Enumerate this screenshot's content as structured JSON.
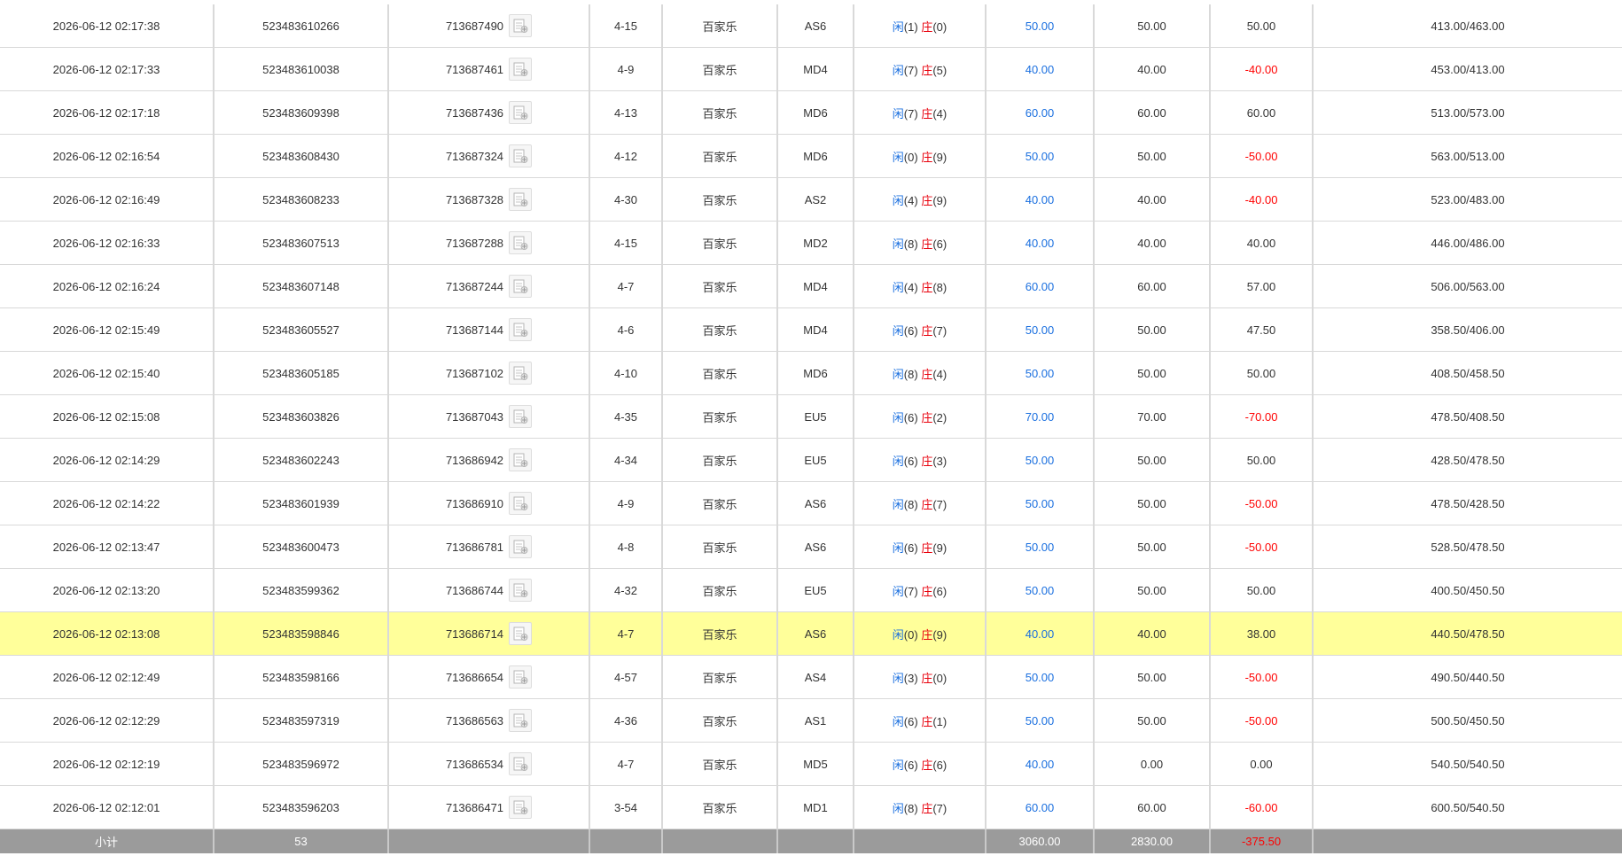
{
  "table": {
    "rows": [
      {
        "time": "2026-06-12 02:17:38",
        "order_no": "523483610266",
        "round_no": "713687490",
        "shoe": "4-15",
        "game": "百家乐",
        "table": "AS6",
        "player_label": "闲",
        "player_pts": "(1)",
        "banker_label": "庄",
        "banker_pts": "(0)",
        "bet": "50.00",
        "valid_bet": "50.00",
        "win_loss": "50.00",
        "win_loss_neg": false,
        "balance": "413.00/463.00",
        "highlight": false
      },
      {
        "time": "2026-06-12 02:17:33",
        "order_no": "523483610038",
        "round_no": "713687461",
        "shoe": "4-9",
        "game": "百家乐",
        "table": "MD4",
        "player_label": "闲",
        "player_pts": "(7)",
        "banker_label": "庄",
        "banker_pts": "(5)",
        "bet": "40.00",
        "valid_bet": "40.00",
        "win_loss": "-40.00",
        "win_loss_neg": true,
        "balance": "453.00/413.00",
        "highlight": false
      },
      {
        "time": "2026-06-12 02:17:18",
        "order_no": "523483609398",
        "round_no": "713687436",
        "shoe": "4-13",
        "game": "百家乐",
        "table": "MD6",
        "player_label": "闲",
        "player_pts": "(7)",
        "banker_label": "庄",
        "banker_pts": "(4)",
        "bet": "60.00",
        "valid_bet": "60.00",
        "win_loss": "60.00",
        "win_loss_neg": false,
        "balance": "513.00/573.00",
        "highlight": false
      },
      {
        "time": "2026-06-12 02:16:54",
        "order_no": "523483608430",
        "round_no": "713687324",
        "shoe": "4-12",
        "game": "百家乐",
        "table": "MD6",
        "player_label": "闲",
        "player_pts": "(0)",
        "banker_label": "庄",
        "banker_pts": "(9)",
        "bet": "50.00",
        "valid_bet": "50.00",
        "win_loss": "-50.00",
        "win_loss_neg": true,
        "balance": "563.00/513.00",
        "highlight": false
      },
      {
        "time": "2026-06-12 02:16:49",
        "order_no": "523483608233",
        "round_no": "713687328",
        "shoe": "4-30",
        "game": "百家乐",
        "table": "AS2",
        "player_label": "闲",
        "player_pts": "(4)",
        "banker_label": "庄",
        "banker_pts": "(9)",
        "bet": "40.00",
        "valid_bet": "40.00",
        "win_loss": "-40.00",
        "win_loss_neg": true,
        "balance": "523.00/483.00",
        "highlight": false
      },
      {
        "time": "2026-06-12 02:16:33",
        "order_no": "523483607513",
        "round_no": "713687288",
        "shoe": "4-15",
        "game": "百家乐",
        "table": "MD2",
        "player_label": "闲",
        "player_pts": "(8)",
        "banker_label": "庄",
        "banker_pts": "(6)",
        "bet": "40.00",
        "valid_bet": "40.00",
        "win_loss": "40.00",
        "win_loss_neg": false,
        "balance": "446.00/486.00",
        "highlight": false
      },
      {
        "time": "2026-06-12 02:16:24",
        "order_no": "523483607148",
        "round_no": "713687244",
        "shoe": "4-7",
        "game": "百家乐",
        "table": "MD4",
        "player_label": "闲",
        "player_pts": "(4)",
        "banker_label": "庄",
        "banker_pts": "(8)",
        "bet": "60.00",
        "valid_bet": "60.00",
        "win_loss": "57.00",
        "win_loss_neg": false,
        "balance": "506.00/563.00",
        "highlight": false
      },
      {
        "time": "2026-06-12 02:15:49",
        "order_no": "523483605527",
        "round_no": "713687144",
        "shoe": "4-6",
        "game": "百家乐",
        "table": "MD4",
        "player_label": "闲",
        "player_pts": "(6)",
        "banker_label": "庄",
        "banker_pts": "(7)",
        "bet": "50.00",
        "valid_bet": "50.00",
        "win_loss": "47.50",
        "win_loss_neg": false,
        "balance": "358.50/406.00",
        "highlight": false
      },
      {
        "time": "2026-06-12 02:15:40",
        "order_no": "523483605185",
        "round_no": "713687102",
        "shoe": "4-10",
        "game": "百家乐",
        "table": "MD6",
        "player_label": "闲",
        "player_pts": "(8)",
        "banker_label": "庄",
        "banker_pts": "(4)",
        "bet": "50.00",
        "valid_bet": "50.00",
        "win_loss": "50.00",
        "win_loss_neg": false,
        "balance": "408.50/458.50",
        "highlight": false
      },
      {
        "time": "2026-06-12 02:15:08",
        "order_no": "523483603826",
        "round_no": "713687043",
        "shoe": "4-35",
        "game": "百家乐",
        "table": "EU5",
        "player_label": "闲",
        "player_pts": "(6)",
        "banker_label": "庄",
        "banker_pts": "(2)",
        "bet": "70.00",
        "valid_bet": "70.00",
        "win_loss": "-70.00",
        "win_loss_neg": true,
        "balance": "478.50/408.50",
        "highlight": false
      },
      {
        "time": "2026-06-12 02:14:29",
        "order_no": "523483602243",
        "round_no": "713686942",
        "shoe": "4-34",
        "game": "百家乐",
        "table": "EU5",
        "player_label": "闲",
        "player_pts": "(6)",
        "banker_label": "庄",
        "banker_pts": "(3)",
        "bet": "50.00",
        "valid_bet": "50.00",
        "win_loss": "50.00",
        "win_loss_neg": false,
        "balance": "428.50/478.50",
        "highlight": false
      },
      {
        "time": "2026-06-12 02:14:22",
        "order_no": "523483601939",
        "round_no": "713686910",
        "shoe": "4-9",
        "game": "百家乐",
        "table": "AS6",
        "player_label": "闲",
        "player_pts": "(8)",
        "banker_label": "庄",
        "banker_pts": "(7)",
        "bet": "50.00",
        "valid_bet": "50.00",
        "win_loss": "-50.00",
        "win_loss_neg": true,
        "balance": "478.50/428.50",
        "highlight": false
      },
      {
        "time": "2026-06-12 02:13:47",
        "order_no": "523483600473",
        "round_no": "713686781",
        "shoe": "4-8",
        "game": "百家乐",
        "table": "AS6",
        "player_label": "闲",
        "player_pts": "(6)",
        "banker_label": "庄",
        "banker_pts": "(9)",
        "bet": "50.00",
        "valid_bet": "50.00",
        "win_loss": "-50.00",
        "win_loss_neg": true,
        "balance": "528.50/478.50",
        "highlight": false
      },
      {
        "time": "2026-06-12 02:13:20",
        "order_no": "523483599362",
        "round_no": "713686744",
        "shoe": "4-32",
        "game": "百家乐",
        "table": "EU5",
        "player_label": "闲",
        "player_pts": "(7)",
        "banker_label": "庄",
        "banker_pts": "(6)",
        "bet": "50.00",
        "valid_bet": "50.00",
        "win_loss": "50.00",
        "win_loss_neg": false,
        "balance": "400.50/450.50",
        "highlight": false
      },
      {
        "time": "2026-06-12 02:13:08",
        "order_no": "523483598846",
        "round_no": "713686714",
        "shoe": "4-7",
        "game": "百家乐",
        "table": "AS6",
        "player_label": "闲",
        "player_pts": "(0)",
        "banker_label": "庄",
        "banker_pts": "(9)",
        "bet": "40.00",
        "valid_bet": "40.00",
        "win_loss": "38.00",
        "win_loss_neg": false,
        "balance": "440.50/478.50",
        "highlight": true
      },
      {
        "time": "2026-06-12 02:12:49",
        "order_no": "523483598166",
        "round_no": "713686654",
        "shoe": "4-57",
        "game": "百家乐",
        "table": "AS4",
        "player_label": "闲",
        "player_pts": "(3)",
        "banker_label": "庄",
        "banker_pts": "(0)",
        "bet": "50.00",
        "valid_bet": "50.00",
        "win_loss": "-50.00",
        "win_loss_neg": true,
        "balance": "490.50/440.50",
        "highlight": false
      },
      {
        "time": "2026-06-12 02:12:29",
        "order_no": "523483597319",
        "round_no": "713686563",
        "shoe": "4-36",
        "game": "百家乐",
        "table": "AS1",
        "player_label": "闲",
        "player_pts": "(6)",
        "banker_label": "庄",
        "banker_pts": "(1)",
        "bet": "50.00",
        "valid_bet": "50.00",
        "win_loss": "-50.00",
        "win_loss_neg": true,
        "balance": "500.50/450.50",
        "highlight": false
      },
      {
        "time": "2026-06-12 02:12:19",
        "order_no": "523483596972",
        "round_no": "713686534",
        "shoe": "4-7",
        "game": "百家乐",
        "table": "MD5",
        "player_label": "闲",
        "player_pts": "(6)",
        "banker_label": "庄",
        "banker_pts": "(6)",
        "bet": "40.00",
        "valid_bet": "0.00",
        "win_loss": "0.00",
        "win_loss_neg": false,
        "balance": "540.50/540.50",
        "highlight": false
      },
      {
        "time": "2026-06-12 02:12:01",
        "order_no": "523483596203",
        "round_no": "713686471",
        "shoe": "3-54",
        "game": "百家乐",
        "table": "MD1",
        "player_label": "闲",
        "player_pts": "(8)",
        "banker_label": "庄",
        "banker_pts": "(7)",
        "bet": "60.00",
        "valid_bet": "60.00",
        "win_loss": "-60.00",
        "win_loss_neg": true,
        "balance": "600.50/540.50",
        "highlight": false
      }
    ],
    "subtotal": {
      "label": "小计",
      "count": "53",
      "bet": "3060.00",
      "valid_bet": "2830.00",
      "win_loss": "-375.50"
    }
  },
  "colors": {
    "player": "#1a6fdf",
    "banker": "#e8000c",
    "bet": "#1a6fdf",
    "negative": "#ff0000",
    "highlight_row": "#ffff9a",
    "subtotal_bg": "#9b9b9b"
  },
  "icons": {
    "detail": "bet-detail-icon"
  }
}
